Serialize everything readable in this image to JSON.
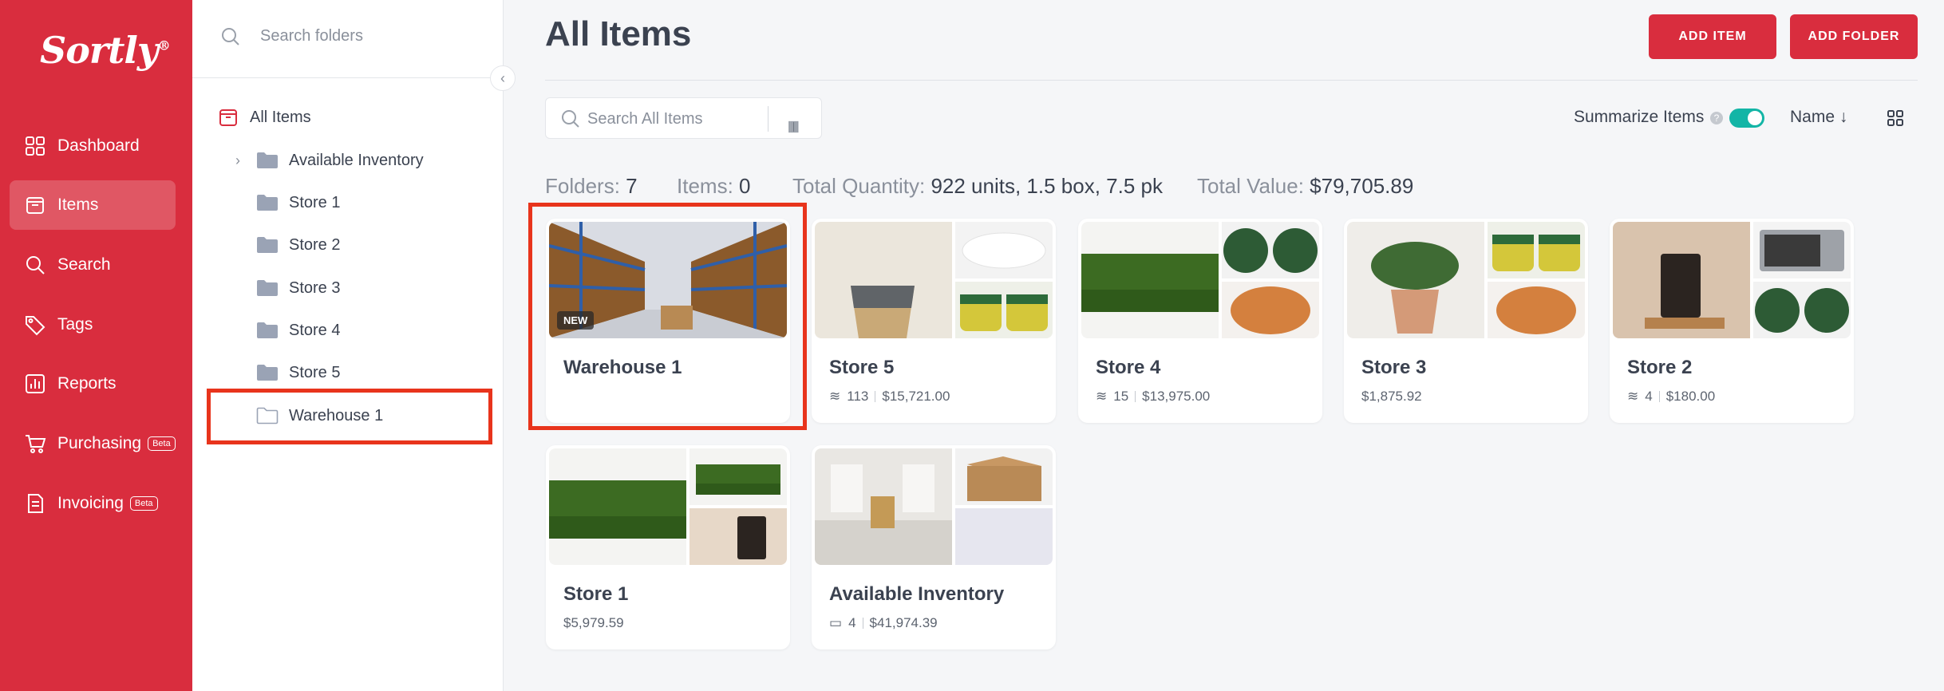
{
  "brand": {
    "name": "Sortly",
    "mark": "®",
    "accent": "#d92d3e",
    "toggle_color": "#13b5a6",
    "highlight": "#e8341c"
  },
  "nav": [
    {
      "label": "Dashboard",
      "icon": "dashboard-icon"
    },
    {
      "label": "Items",
      "icon": "items-icon",
      "active": true
    },
    {
      "label": "Search",
      "icon": "search-icon"
    },
    {
      "label": "Tags",
      "icon": "tag-icon"
    },
    {
      "label": "Reports",
      "icon": "reports-icon"
    },
    {
      "label": "Purchasing",
      "icon": "cart-icon",
      "badge": "Beta"
    },
    {
      "label": "Invoicing",
      "icon": "invoice-icon",
      "badge": "Beta"
    }
  ],
  "folder_panel": {
    "search_placeholder": "Search folders",
    "root": "All Items",
    "folders": [
      "Available Inventory",
      "Store 1",
      "Store 2",
      "Store 3",
      "Store 4",
      "Store 5",
      "Warehouse 1"
    ]
  },
  "header": {
    "title": "All Items",
    "add_item": "ADD ITEM",
    "add_folder": "ADD FOLDER"
  },
  "toolbar": {
    "search_placeholder": "Search All Items",
    "summarize_label": "Summarize Items",
    "summarize_on": true,
    "sort_label": "Name"
  },
  "stats": {
    "folders_label": "Folders:",
    "folders": "7",
    "items_label": "Items:",
    "items": "0",
    "qty_label": "Total Quantity:",
    "qty": "922 units, 1.5 box, 7.5 pk",
    "value_label": "Total Value:",
    "value": "$79,705.89"
  },
  "cards": [
    {
      "name": "Warehouse 1",
      "badge": "NEW",
      "qty": "",
      "value": ""
    },
    {
      "name": "Store 5",
      "qty": "113",
      "value": "$15,721.00"
    },
    {
      "name": "Store 4",
      "qty": "15",
      "value": "$13,975.00"
    },
    {
      "name": "Store 3",
      "qty": "",
      "value": "$1,875.92"
    },
    {
      "name": "Store 2",
      "qty": "4",
      "value": "$180.00"
    },
    {
      "name": "Store 1",
      "qty": "",
      "value": "$5,979.59"
    },
    {
      "name": "Available Inventory",
      "qty": "4",
      "value": "$41,974.39"
    }
  ]
}
